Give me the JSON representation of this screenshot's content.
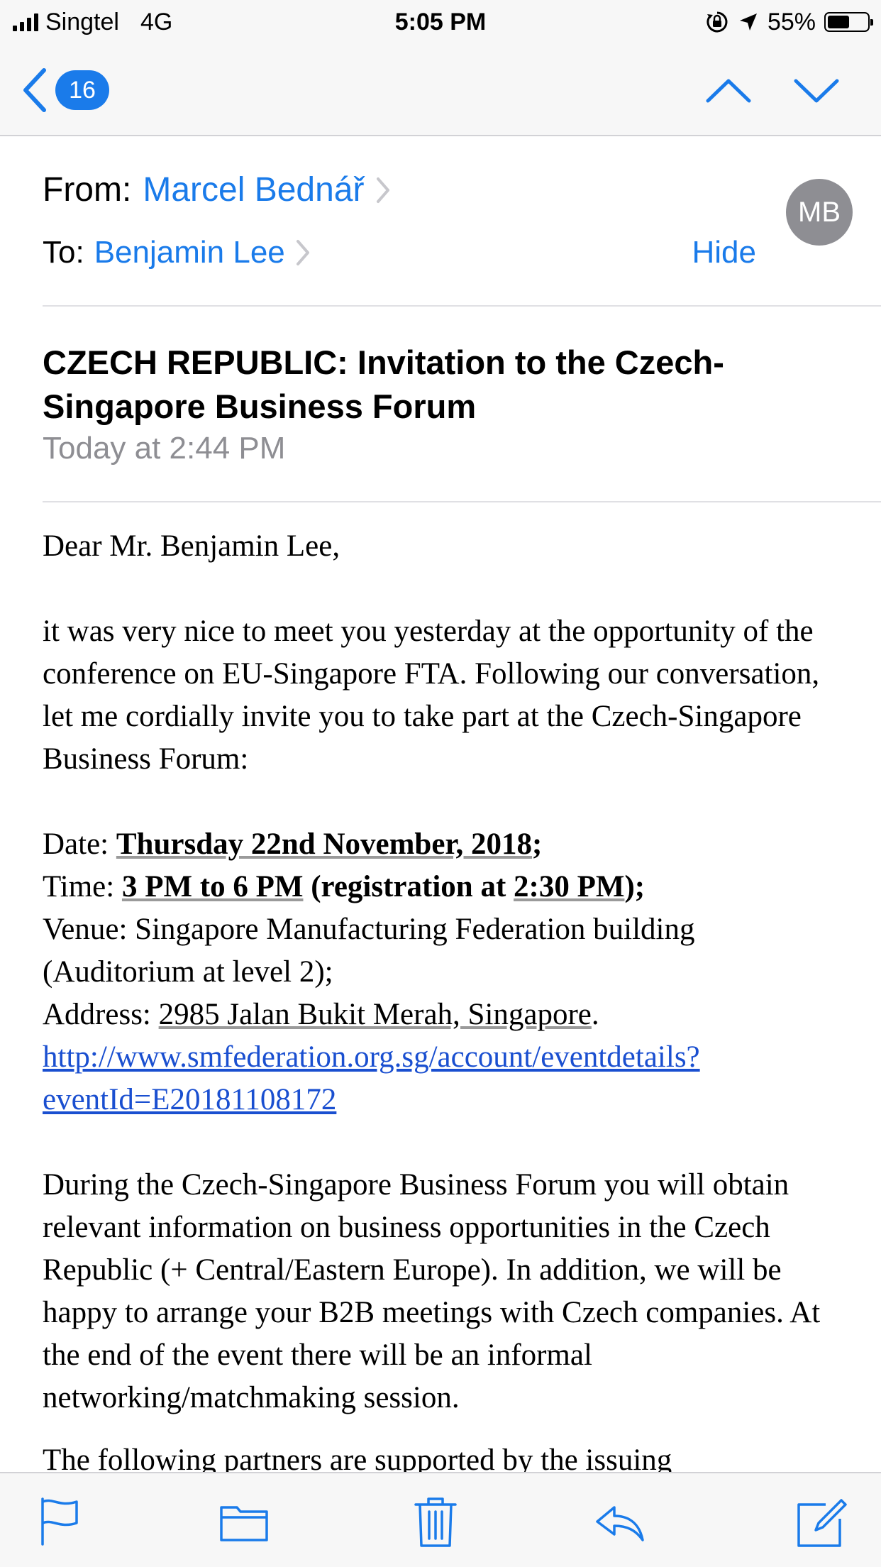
{
  "status_bar": {
    "carrier": "Singtel",
    "network": "4G",
    "time": "5:05 PM",
    "battery": "55%",
    "battery_level": 0.55
  },
  "nav": {
    "back_count": "16",
    "icons": [
      "chevron-left-icon",
      "chevron-up-icon",
      "chevron-down-icon"
    ]
  },
  "header": {
    "from_label": "From:",
    "from_name": "Marcel Bednář",
    "to_label": "To:",
    "to_name": "Benjamin Lee",
    "hide_label": "Hide",
    "avatar_initials": "MB"
  },
  "subject": "CZECH REPUBLIC: Invitation to the Czech-Singapore Business Forum",
  "date": "Today at 2:44 PM",
  "body": {
    "greeting": "Dear Mr. Benjamin Lee,",
    "intro": "it was very nice to meet you yesterday at the opportunity of the conference on EU-Singapore FTA. Following our conversation, let me cordially invite you to take part at the Czech-Singapore Business Forum:",
    "date_label": "Date: ",
    "date_value": "Thursday 22nd November, 2018",
    "date_end": ";",
    "time_label": "Time: ",
    "time_value": "3 PM to 6 PM",
    "time_extra_a": " (registration at ",
    "time_extra_b": "2:30 PM",
    "time_end": ");",
    "venue": "Venue: Singapore Manufacturing Federation building (Auditorium at level 2);",
    "address_label": "Address: ",
    "address_value": "2985 Jalan Bukit Merah, Singapore",
    "address_end": ".",
    "link": "http://www.smfederation.org.sg/account/eventdetails?eventId=E20181108172",
    "paragraph2": "During the Czech-Singapore Business Forum you will obtain relevant information on business opportunities in the Czech Republic (+ Central/Eastern Europe). In addition, we will be happy to arrange your B2B meetings with Czech companies. At the end of the event there will be an informal networking/matchmaking session.",
    "cut_off_line": "The following partners are supported by the issuing"
  },
  "toolbar": {
    "icons": [
      "flag-icon",
      "folder-icon",
      "trash-icon",
      "reply-icon",
      "compose-icon"
    ]
  },
  "colors": {
    "accent": "#1a7bea",
    "secondary_text": "#8e8e93",
    "bar_background": "#f7f7f7"
  }
}
